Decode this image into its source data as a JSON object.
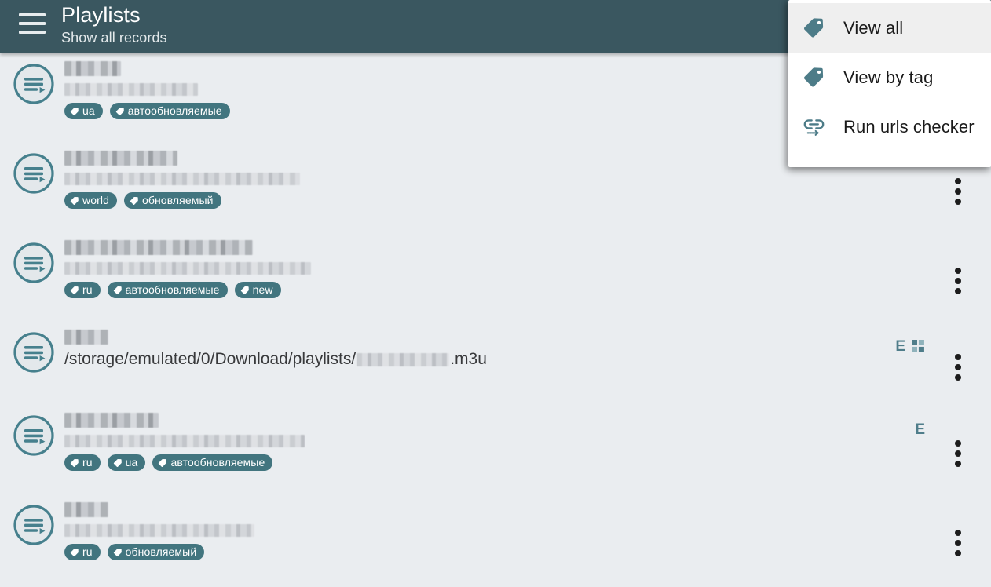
{
  "appbar": {
    "menu_icon": "hamburger-icon",
    "title": "Playlists",
    "subtitle": "Show all records",
    "background_color": "#3a5760",
    "title_color": "#ffffff"
  },
  "overflow_menu": {
    "visible": true,
    "background_color": "#ffffff",
    "highlight_color": "#efefef",
    "icon_color": "#4d7c88",
    "items": [
      {
        "label": "View all",
        "icon": "tag-icon",
        "highlighted": true
      },
      {
        "label": "View by tag",
        "icon": "tag-icon",
        "highlighted": false
      },
      {
        "label": "Run urls checker",
        "icon": "link-checker-icon",
        "highlighted": false
      }
    ]
  },
  "theme": {
    "page_background": "#eaedf0",
    "accent": "#42757f",
    "chip_background": "#42757f",
    "chip_text": "#ffffff",
    "kebab_color": "#1c1c1c",
    "badge_color": "#4f7d8a"
  },
  "playlists": {
    "row_icon": "playlist-play-icon",
    "kebab_icon": "more-vertical-icon",
    "items": [
      {
        "title_redacted": true,
        "title_width": 72,
        "subtitle_redacted": true,
        "subtitle_width": 170,
        "subtitle_text": "",
        "tags": [
          "ua",
          "автообновляемые"
        ],
        "badges": []
      },
      {
        "title_redacted": true,
        "title_width": 144,
        "subtitle_redacted": true,
        "subtitle_width": 300,
        "subtitle_text": "",
        "tags": [
          "world",
          "обновляемый"
        ],
        "badges": []
      },
      {
        "title_redacted": true,
        "title_width": 240,
        "subtitle_redacted": true,
        "subtitle_width": 314,
        "subtitle_text": "",
        "tags": [
          "ru",
          "автообновляемые",
          "new"
        ],
        "badges": []
      },
      {
        "title_redacted": true,
        "title_width": 56,
        "subtitle_redacted": false,
        "subtitle_text_prefix": "/storage/emulated/0/Download/playlists/",
        "subtitle_text_suffix": ".m3u",
        "tags": [],
        "badges": [
          "E",
          "grid-icon"
        ]
      },
      {
        "title_redacted": true,
        "title_width": 120,
        "subtitle_redacted": true,
        "subtitle_width": 306,
        "subtitle_text": "",
        "tags": [
          "ru",
          "ua",
          "автообновляемые"
        ],
        "badges": [
          "E"
        ]
      },
      {
        "title_redacted": true,
        "title_width": 56,
        "subtitle_redacted": true,
        "subtitle_width": 242,
        "subtitle_text": "",
        "tags": [
          "ru",
          "обновляемый"
        ],
        "badges": []
      }
    ]
  }
}
